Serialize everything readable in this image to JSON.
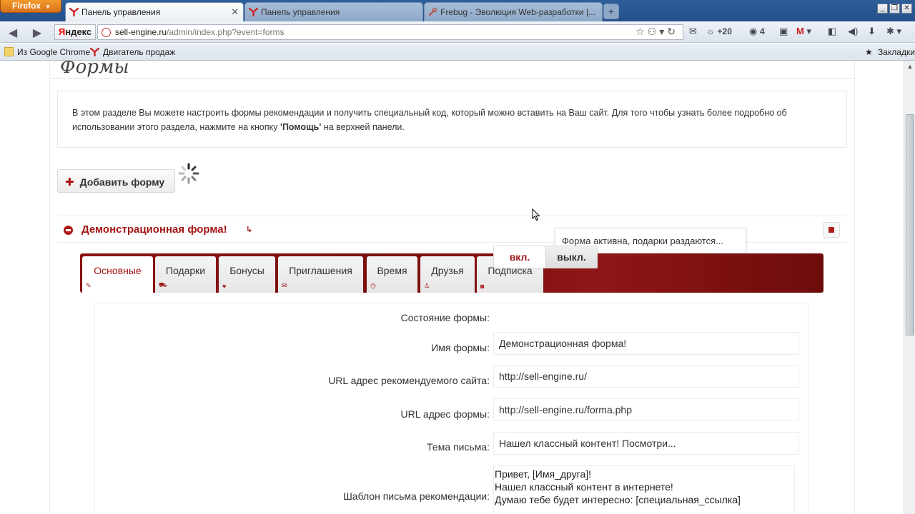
{
  "browser": {
    "firefox_label": "Firefox",
    "tabs": [
      {
        "title": "Панель управления",
        "active": true
      },
      {
        "title": "Панель управления",
        "active": false
      },
      {
        "title": "Frebug - Эволюция Web-разработки |...",
        "active": false
      }
    ],
    "newtab_symbol": "+",
    "yandex_label_y": "Я",
    "yandex_label_rest": "ндекс",
    "url_host": "sell-engine.ru",
    "url_path": "/admin/index.php?event=forms",
    "ext_weather": "+20",
    "ext_count": "4",
    "bookmarks": [
      {
        "label": "Из Google Chrome"
      },
      {
        "label": "Двигатель продаж"
      }
    ],
    "bookmarks_right": "Закладки"
  },
  "page": {
    "title": "Формы",
    "info_text_1": "В этом разделе Вы можете настроить формы рекомендации и получить специальный код, который можно вставить на Ваш сайт. Для того чтобы узнать более подробно об",
    "info_text_2": "использовании этого раздела, нажмите на кнопку ",
    "info_text_bold": "'Помощь'",
    "info_text_3": " на верхней панели.",
    "add_form_label": "Добавить форму",
    "section_title": "Демонстрационная форма!",
    "tooltip": "Форма активна, подарки раздаются...",
    "tabs": [
      {
        "label": "Основные"
      },
      {
        "label": "Подарки"
      },
      {
        "label": "Бонусы"
      },
      {
        "label": "Приглашения"
      },
      {
        "label": "Время"
      },
      {
        "label": "Друзья"
      },
      {
        "label": "Подписка"
      }
    ],
    "form": {
      "state_label": "Состояние формы:",
      "state_on": "вкл.",
      "state_off": "выкл.",
      "name_label": "Имя формы:",
      "name_value": "Демонстрационная форма!",
      "site_url_label": "URL адрес рекомендуемого сайта:",
      "site_url_value": "http://sell-engine.ru/",
      "form_url_label": "URL адрес формы:",
      "form_url_value": "http://sell-engine.ru/forma.php",
      "subject_label": "Тема письма:",
      "subject_value": "Нашел классный контент! Посмотри...",
      "template_label": "Шаблон письма рекомендации:",
      "template_lines": [
        "Привет, [Имя_друга]!",
        "Нашел классный контент в интернете!",
        "Думаю тебе будет интересно: [специальная_ссылка]"
      ]
    }
  },
  "colors": {
    "accent": "#a31616",
    "tabstrip": "#7a0f0f"
  }
}
